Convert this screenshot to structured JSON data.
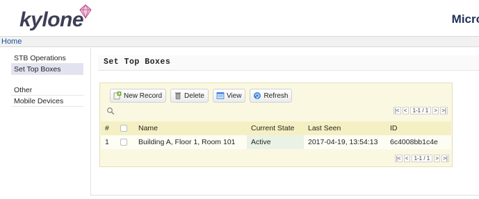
{
  "header": {
    "logo_text": "kylone",
    "app_title": "Micro"
  },
  "breadcrumb": {
    "home": "Home"
  },
  "sidebar": {
    "groups": [
      {
        "heading": "STB Operations",
        "items": [
          {
            "label": "Set Top Boxes",
            "active": true
          }
        ]
      },
      {
        "heading": "Other",
        "items": [
          {
            "label": "Mobile Devices",
            "active": false
          }
        ]
      }
    ]
  },
  "main": {
    "title": "Set Top Boxes"
  },
  "toolbar": {
    "new_record": "New Record",
    "delete": "Delete",
    "view": "View",
    "refresh": "Refresh"
  },
  "pager": {
    "first": "|<",
    "prev": "<",
    "info": "1-1 / 1",
    "next": ">",
    "last": ">|"
  },
  "table": {
    "columns": [
      "#",
      "",
      "Name",
      "Current State",
      "Last Seen",
      "ID"
    ],
    "rows": [
      {
        "num": "1",
        "name": "Building A, Floor 1, Room 101",
        "state": "Active",
        "last_seen": "2017-04-19, 13:54:13",
        "id": "6c4008bb1c4e"
      }
    ]
  },
  "colors": {
    "grid_background": "#fbf8e2",
    "header_row": "#f5f0c4",
    "active_cell": "#e9f2e4",
    "sidebar_active": "#e2e2f0",
    "logo": "#3e3e56",
    "title": "#1f2f5c"
  },
  "icons": {
    "new_record": "add-record-icon",
    "delete": "trash-icon",
    "view": "view-list-icon",
    "refresh": "refresh-icon",
    "search": "search-icon",
    "logo_gem": "gem-icon"
  }
}
